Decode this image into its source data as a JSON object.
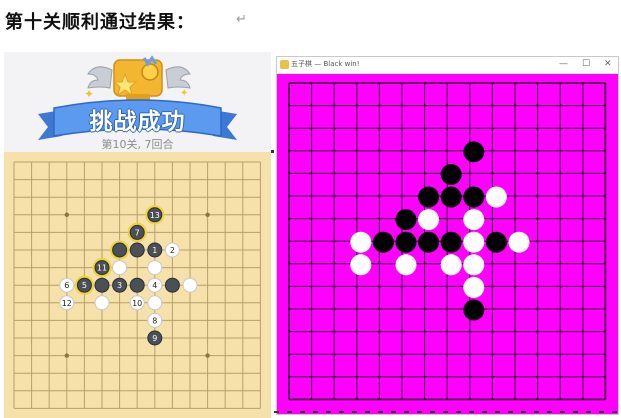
{
  "document": {
    "heading": "第十关顺利通过结果：",
    "paragraph_mark": "↵"
  },
  "left_screenshot": {
    "banner_text": "挑战成功",
    "subtitle": "第10关, 7回合",
    "colors": {
      "board": "#f5e1a9",
      "grid_line": "#b9a06a",
      "banner_blue": "#4f8ee8",
      "trophy_gold": "#f2b630",
      "black_stone": "#4a4f58",
      "white_stone": "#ffffff",
      "highlight_ring": "#f0d23a"
    },
    "board_size": 15,
    "stones": [
      {
        "col": 8,
        "row": 3,
        "color": "black",
        "label": "13",
        "ring": true
      },
      {
        "col": 7,
        "row": 4,
        "color": "black",
        "label": "7",
        "ring": true
      },
      {
        "col": 6,
        "row": 5,
        "color": "black",
        "label": "",
        "ring": true
      },
      {
        "col": 7,
        "row": 5,
        "color": "black",
        "label": "",
        "ring": false
      },
      {
        "col": 8,
        "row": 5,
        "color": "black",
        "label": "1",
        "ring": false
      },
      {
        "col": 9,
        "row": 5,
        "color": "white",
        "label": "2",
        "ring": false
      },
      {
        "col": 5,
        "row": 6,
        "color": "black",
        "label": "11",
        "ring": true
      },
      {
        "col": 6,
        "row": 6,
        "color": "white",
        "label": "",
        "ring": false
      },
      {
        "col": 8,
        "row": 6,
        "color": "white",
        "label": "",
        "ring": false
      },
      {
        "col": 3,
        "row": 7,
        "color": "white",
        "label": "6",
        "ring": false
      },
      {
        "col": 4,
        "row": 7,
        "color": "black",
        "label": "5",
        "ring": true
      },
      {
        "col": 5,
        "row": 7,
        "color": "black",
        "label": "",
        "ring": false
      },
      {
        "col": 6,
        "row": 7,
        "color": "black",
        "label": "3",
        "ring": false
      },
      {
        "col": 7,
        "row": 7,
        "color": "black",
        "label": "",
        "ring": false
      },
      {
        "col": 8,
        "row": 7,
        "color": "white",
        "label": "4",
        "ring": false
      },
      {
        "col": 9,
        "row": 7,
        "color": "black",
        "label": "",
        "ring": false
      },
      {
        "col": 10,
        "row": 7,
        "color": "white",
        "label": "",
        "ring": false
      },
      {
        "col": 3,
        "row": 8,
        "color": "white",
        "label": "12",
        "ring": false
      },
      {
        "col": 5,
        "row": 8,
        "color": "white",
        "label": "",
        "ring": false
      },
      {
        "col": 7,
        "row": 8,
        "color": "white",
        "label": "10",
        "ring": false
      },
      {
        "col": 8,
        "row": 8,
        "color": "white",
        "label": "",
        "ring": false
      },
      {
        "col": 8,
        "row": 9,
        "color": "white",
        "label": "8",
        "ring": false
      },
      {
        "col": 8,
        "row": 10,
        "color": "black",
        "label": "9",
        "ring": false
      }
    ]
  },
  "right_screenshot": {
    "window_title": "五子棋 — Black win!",
    "controls": {
      "minimize": "—",
      "maximize": "☐",
      "close": "✕"
    },
    "colors": {
      "background": "#ff00ff",
      "grid_line": "#2a002a",
      "black_stone": "#000000",
      "white_stone": "#ffffff"
    },
    "grid_cols": 14,
    "grid_rows": 14,
    "stones": [
      {
        "col": 8,
        "row": 3,
        "color": "black"
      },
      {
        "col": 7,
        "row": 4,
        "color": "black"
      },
      {
        "col": 6,
        "row": 5,
        "color": "black"
      },
      {
        "col": 7,
        "row": 5,
        "color": "black"
      },
      {
        "col": 8,
        "row": 5,
        "color": "black"
      },
      {
        "col": 9,
        "row": 5,
        "color": "white"
      },
      {
        "col": 5,
        "row": 6,
        "color": "black"
      },
      {
        "col": 6,
        "row": 6,
        "color": "white"
      },
      {
        "col": 8,
        "row": 6,
        "color": "white"
      },
      {
        "col": 3,
        "row": 7,
        "color": "white"
      },
      {
        "col": 4,
        "row": 7,
        "color": "black"
      },
      {
        "col": 5,
        "row": 7,
        "color": "black"
      },
      {
        "col": 6,
        "row": 7,
        "color": "black"
      },
      {
        "col": 7,
        "row": 7,
        "color": "black"
      },
      {
        "col": 8,
        "row": 7,
        "color": "white"
      },
      {
        "col": 9,
        "row": 7,
        "color": "black"
      },
      {
        "col": 10,
        "row": 7,
        "color": "white"
      },
      {
        "col": 3,
        "row": 8,
        "color": "white"
      },
      {
        "col": 5,
        "row": 8,
        "color": "white"
      },
      {
        "col": 7,
        "row": 8,
        "color": "white"
      },
      {
        "col": 8,
        "row": 8,
        "color": "white"
      },
      {
        "col": 8,
        "row": 9,
        "color": "white"
      },
      {
        "col": 8,
        "row": 10,
        "color": "black"
      }
    ]
  }
}
